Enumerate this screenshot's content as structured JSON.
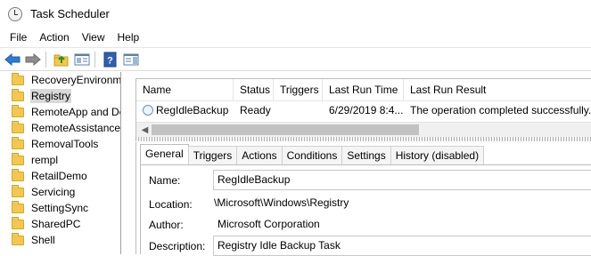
{
  "window": {
    "title": "Task Scheduler"
  },
  "menu": [
    "File",
    "Action",
    "View",
    "Help"
  ],
  "toolbar": {
    "buttons": [
      "back-arrow-icon",
      "forward-arrow-icon",
      "up-folder-icon",
      "show-hide-tree-icon",
      "help-icon",
      "action-pane-icon"
    ]
  },
  "tree": {
    "items": [
      {
        "label": "RecoveryEnvironment"
      },
      {
        "label": "Registry",
        "selected": true
      },
      {
        "label": "RemoteApp and Desktop Connections Update"
      },
      {
        "label": "RemoteAssistance"
      },
      {
        "label": "RemovalTools"
      },
      {
        "label": "rempl"
      },
      {
        "label": "RetailDemo"
      },
      {
        "label": "Servicing"
      },
      {
        "label": "SettingSync"
      },
      {
        "label": "SharedPC"
      },
      {
        "label": "Shell"
      }
    ]
  },
  "task_list": {
    "columns": [
      "Name",
      "Status",
      "Triggers",
      "Last Run Time",
      "Last Run Result"
    ],
    "rows": [
      {
        "name": "RegIdleBackup",
        "status": "Ready",
        "triggers": "",
        "last_run_time": "6/29/2019 8:4...",
        "last_run_result": "The operation completed successfully."
      }
    ]
  },
  "detail": {
    "tabs": [
      {
        "label": "General",
        "active": true
      },
      {
        "label": "Triggers"
      },
      {
        "label": "Actions"
      },
      {
        "label": "Conditions"
      },
      {
        "label": "Settings"
      },
      {
        "label": "History (disabled)"
      }
    ],
    "fields": {
      "name_label": "Name:",
      "name_value": "RegIdleBackup",
      "location_label": "Location:",
      "location_value": "\\Microsoft\\Windows\\Registry",
      "author_label": "Author:",
      "author_value": "Microsoft Corporation",
      "description_label": "Description:",
      "description_value": "Registry Idle Backup Task"
    }
  }
}
